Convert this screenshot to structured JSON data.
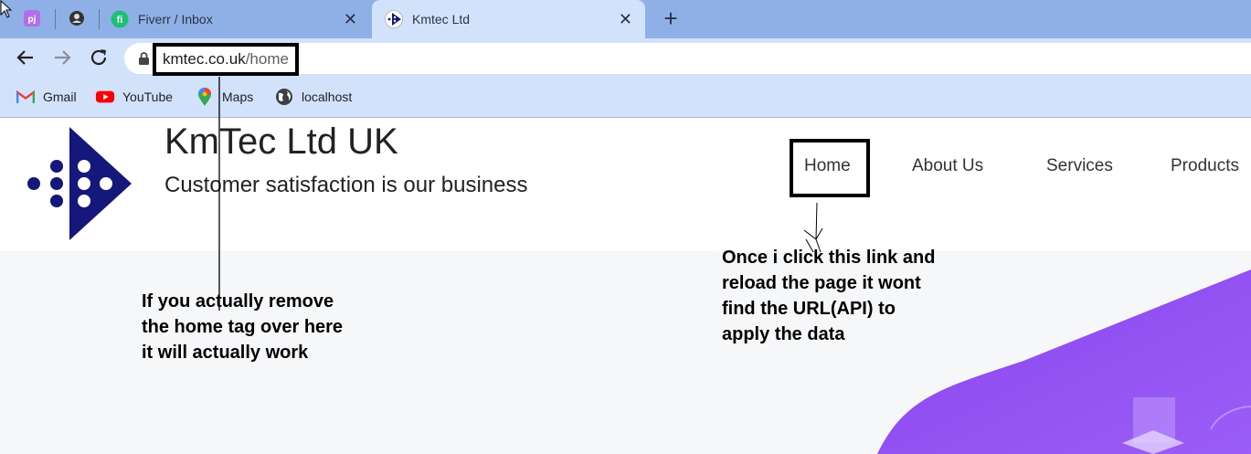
{
  "browser": {
    "tabs": [
      {
        "label": "Fiverr / Inbox",
        "icon": "fiverr-icon",
        "close": "✕"
      },
      {
        "label": "Kmtec Ltd",
        "icon": "kmtec-icon",
        "close": "✕"
      }
    ],
    "pinned_tabs": [
      {
        "icon": "pj-app-icon",
        "text": "pj"
      },
      {
        "icon": "user-profile-icon"
      }
    ],
    "new_tab": "+",
    "address": {
      "host": "kmtec.co.uk",
      "path": "/home"
    },
    "bookmarks": [
      {
        "label": "Gmail",
        "icon": "gmail-icon"
      },
      {
        "label": "YouTube",
        "icon": "youtube-icon"
      },
      {
        "label": "Maps",
        "icon": "maps-icon"
      },
      {
        "label": "localhost",
        "icon": "globe-icon"
      }
    ]
  },
  "site": {
    "brand_name": "KmTec Ltd UK",
    "tagline": "Customer satisfaction is our business",
    "nav": [
      {
        "label": "Home"
      },
      {
        "label": "About Us"
      },
      {
        "label": "Services"
      },
      {
        "label": "Products"
      }
    ],
    "colors": {
      "logo": "#15177a",
      "hero": "#8d4ff0"
    }
  },
  "annotations": {
    "left_note": "If you actually remove\nthe home tag over here\nit will actually work",
    "right_note": "Once i click this link and\nreload the page it wont\nfind the URL(API) to\napply the data"
  }
}
